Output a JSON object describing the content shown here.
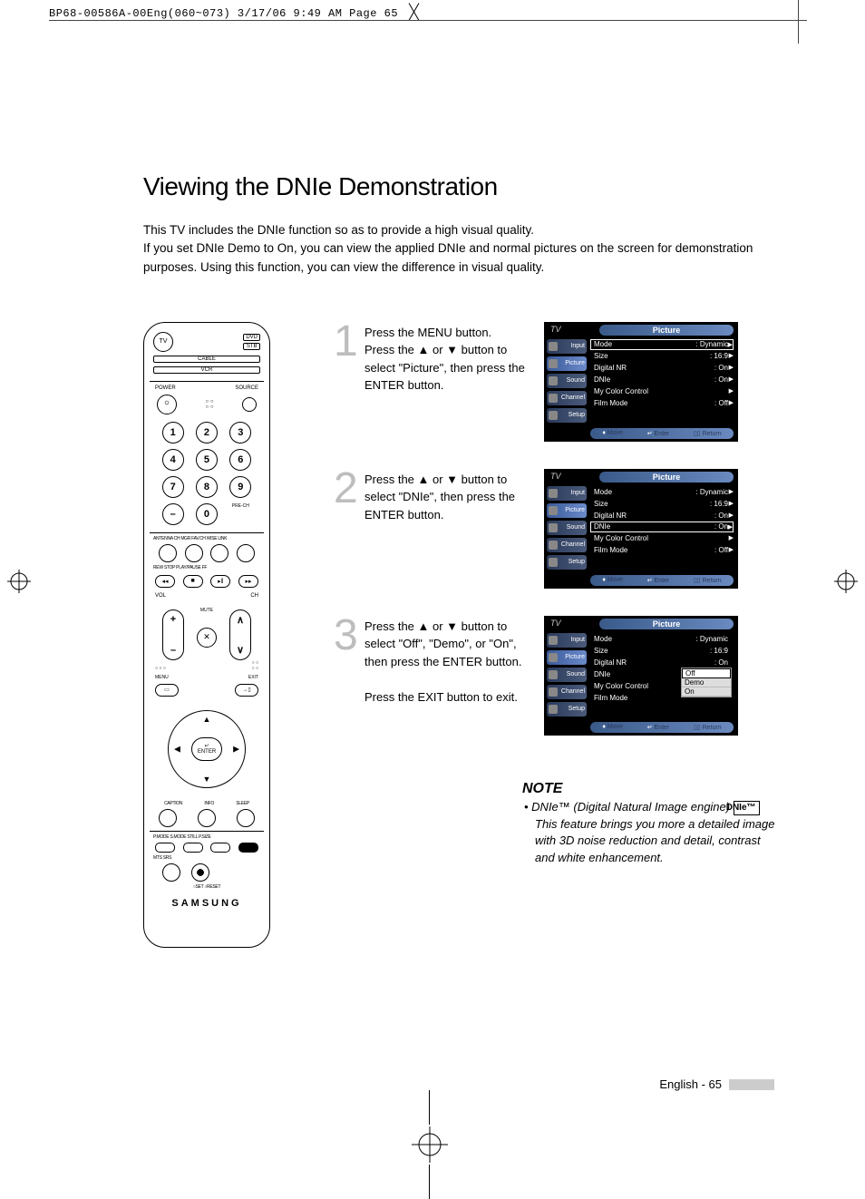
{
  "slug": "BP68-00586A-00Eng(060~073)  3/17/06  9:49 AM  Page 65",
  "title": "Viewing the DNIe Demonstration",
  "intro": "This TV includes the DNIe function so as to provide a high visual quality.\nIf you set DNIe Demo to On, you can view the applied DNIe and normal pictures on the screen for demonstration purposes. Using this function, you can view the difference in visual quality.",
  "remote": {
    "tv": "TV",
    "dev1a": "DVD",
    "dev1b": "STB",
    "dev2a": "CABLE",
    "dev2b": "VCR",
    "power": "POWER",
    "source": "SOURCE",
    "prech": "PRE-CH",
    "row_antenna": "ANTENNA  CH MGR   FAV.CH   WISE LINK",
    "row_trans": "REW       STOP    PLAY/PAUSE    FF",
    "vol": "VOL",
    "ch": "CH",
    "mute": "MUTE",
    "menu": "MENU",
    "exit": "EXIT",
    "enter": "ENTER",
    "caption": "CAPTION",
    "info": "INFO",
    "sleep": "SLEEP",
    "row_pm": "P.MODE   S.MODE    STILL    P.SIZE",
    "row_mts": "MTS        SRS",
    "row_set": "○SET    ○RESET",
    "brand": "SAMSUNG"
  },
  "steps": [
    {
      "num": "1",
      "text": "Press the MENU button.\nPress the ▲ or ▼ button to select \"Picture\", then press the ENTER button."
    },
    {
      "num": "2",
      "text": "Press the ▲ or ▼ button to select \"DNIe\", then press the ENTER button."
    },
    {
      "num": "3",
      "text": "Press the ▲ or ▼ button to select \"Off\", \"Demo\", or \"On\", then press the ENTER button.\n\nPress the EXIT button to exit."
    }
  ],
  "osd": {
    "tv": "TV",
    "title": "Picture",
    "sidebar": [
      "Input",
      "Picture",
      "Sound",
      "Channel",
      "Setup"
    ],
    "rows": [
      {
        "l": "Mode",
        "r": ": Dynamic"
      },
      {
        "l": "Size",
        "r": ": 16:9"
      },
      {
        "l": "Digital NR",
        "r": ": On"
      },
      {
        "l": "DNIe",
        "r": ": On"
      },
      {
        "l": "My Color Control",
        "r": ""
      },
      {
        "l": "Film Mode",
        "r": ": Off"
      }
    ],
    "rows3": [
      {
        "l": "Mode",
        "r": ": Dynamic"
      },
      {
        "l": "Size",
        "r": ": 16:9"
      },
      {
        "l": "Digital NR",
        "r": ": On"
      },
      {
        "l": "DNIe",
        "r": ""
      },
      {
        "l": "My Color Control",
        "r": ""
      },
      {
        "l": "Film Mode",
        "r": ""
      }
    ],
    "popup": [
      "Off",
      "Demo",
      "On"
    ],
    "help": {
      "move": "Move",
      "enter": "Enter",
      "return": "Return"
    }
  },
  "note": {
    "heading": "NOTE",
    "bullet": "• ",
    "line1": "DNIe™ (Digital Natural Image engine) ",
    "logo": "DNIe™",
    "line2": "This feature brings you more a detailed image with 3D noise reduction and detail, contrast and white enhancement."
  },
  "footer": "English - 65"
}
